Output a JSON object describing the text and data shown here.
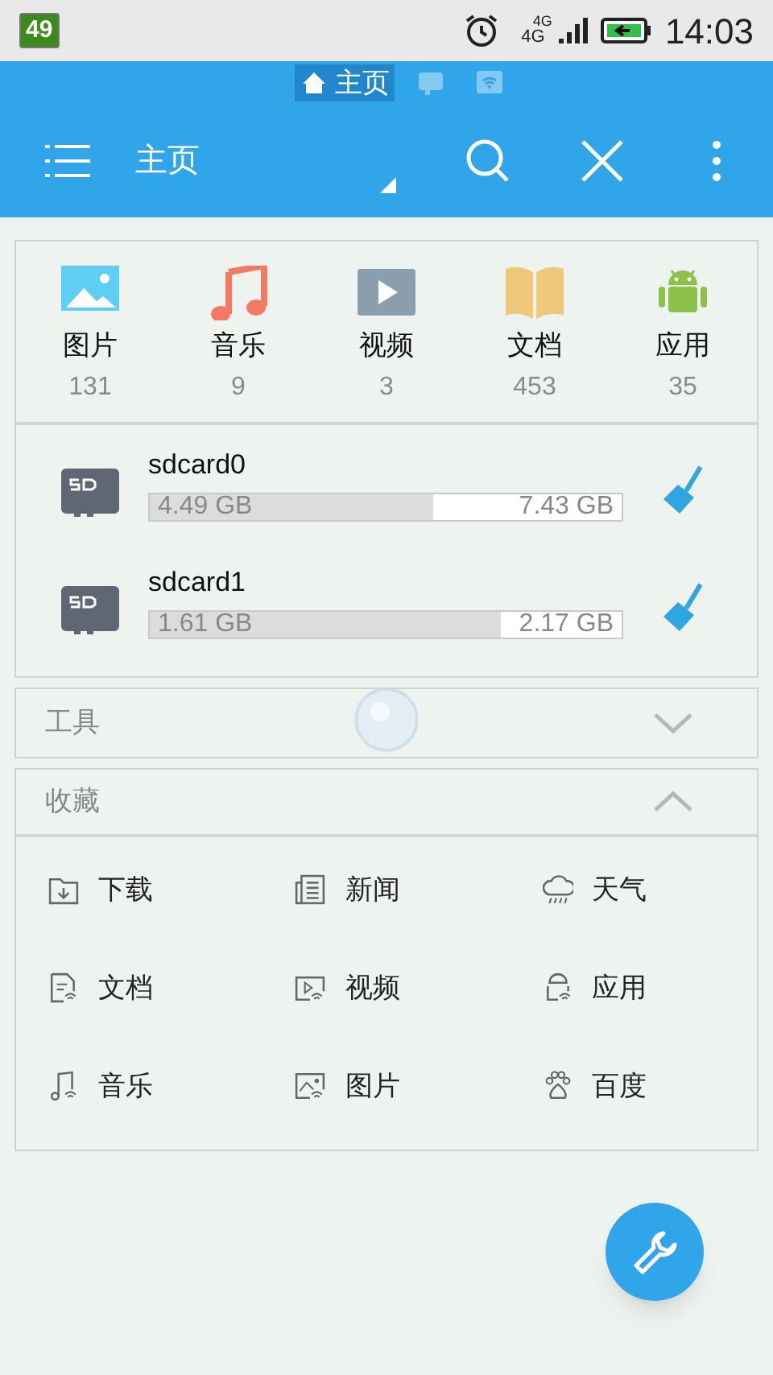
{
  "status_bar": {
    "battery_percent": "49",
    "network_top": "4G",
    "network_bottom": "4G",
    "time": "14:03"
  },
  "location_tabs": [
    {
      "kind": "home",
      "label": "主页",
      "selected": true
    },
    {
      "kind": "sd",
      "selected": false
    },
    {
      "kind": "wifi",
      "selected": false
    }
  ],
  "toolbar": {
    "title": "主页"
  },
  "categories": [
    {
      "kind": "images",
      "label": "图片",
      "count": "131"
    },
    {
      "kind": "music",
      "label": "音乐",
      "count": "9"
    },
    {
      "kind": "video",
      "label": "视频",
      "count": "3"
    },
    {
      "kind": "docs",
      "label": "文档",
      "count": "453"
    },
    {
      "kind": "apps",
      "label": "应用",
      "count": "35"
    }
  ],
  "storage": [
    {
      "name": "sdcard0",
      "used": "4.49 GB",
      "total": "7.43 GB",
      "level": 0.6
    },
    {
      "name": "sdcard1",
      "used": "1.61 GB",
      "total": "2.17 GB",
      "level": 0.745
    }
  ],
  "sections": [
    {
      "title": "工具",
      "expanded": false
    },
    {
      "title": "收藏",
      "expanded": true,
      "items": [
        {
          "kind": "download",
          "label": "下载"
        },
        {
          "kind": "news",
          "label": "新闻"
        },
        {
          "kind": "weather",
          "label": "天气"
        },
        {
          "kind": "doc",
          "label": "文档"
        },
        {
          "kind": "video",
          "label": "视频"
        },
        {
          "kind": "app",
          "label": "应用"
        },
        {
          "kind": "music",
          "label": "音乐"
        },
        {
          "kind": "image",
          "label": "图片"
        },
        {
          "kind": "paw",
          "label": "百度"
        }
      ]
    }
  ]
}
